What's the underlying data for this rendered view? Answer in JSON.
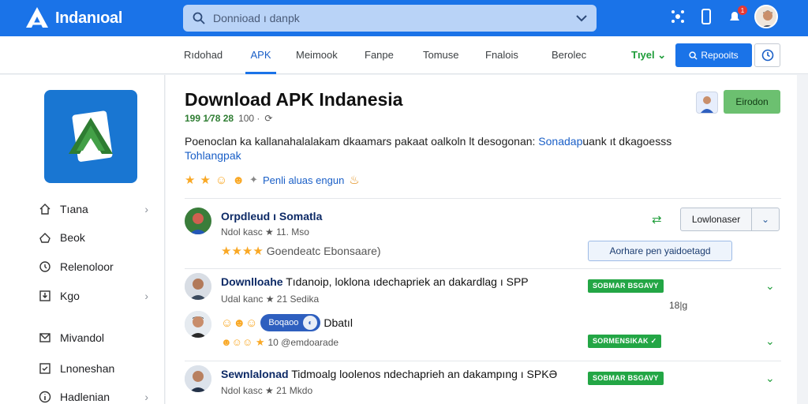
{
  "header": {
    "logo_text": "Indanıoal",
    "search_placeholder": "Donnioad ı danpk",
    "notification_count": "1"
  },
  "nav": {
    "tabs": [
      "Rıdohad",
      "APK",
      "Meimook",
      "Fanpe",
      "Tomuse",
      "Fnalois",
      "Berolec"
    ],
    "active_tab": "APK",
    "extra_tab": "Tıyel",
    "report_button": "Repooits"
  },
  "sidebar": {
    "items": [
      {
        "label": "Tıana",
        "icon": "house-icon",
        "chevron": true
      },
      {
        "label": "Beok",
        "icon": "home-outline-icon",
        "chevron": false
      },
      {
        "label": "Relenoloor",
        "icon": "clock-icon",
        "chevron": false
      },
      {
        "label": "Kgo",
        "icon": "download-box-icon",
        "chevron": true
      },
      {
        "label": "Mivandol",
        "icon": "mail-icon",
        "chevron": false
      },
      {
        "label": "Lnoneshan",
        "icon": "checkbox-icon",
        "chevron": false
      },
      {
        "label": "Hadlenian",
        "icon": "info-icon",
        "chevron": true
      }
    ]
  },
  "app": {
    "title": "Download APK Indanesia",
    "rating_text": "199 1⁄78 28",
    "downloads": "100 ·",
    "description_main": "Poenoclan ka kallanahalalakam dkaamars pakaat oalkoln lt desogonan: ",
    "description_link": "Sonadap",
    "description_rest": "uank ıt dkagoesss",
    "description_line2": "Tohlangpak",
    "stars_label": "Penli aluas engun",
    "download_button": "Eirodon"
  },
  "reviews": [
    {
      "name": "Orpdleud ı Somatla",
      "sub": "Ndol kasc ★ 11. Mso",
      "stars_text": "Goendeatc Ebonsaare)",
      "action_label": "Lowlonaser",
      "blue_button": "Aorhare pen yaidoetagd"
    },
    {
      "name": "Downlloahe",
      "name_rest": " Tıdanoip, loklona ıdechapriek an dakardlag ı SPP",
      "sub": "Udal kanc ★ 21 Sedika",
      "badge": "SOBMAR BSGAVY",
      "count": "18|g"
    },
    {
      "pill_label": "Boqaoo",
      "name_after": "Dbatıl",
      "stars_text": "10 @emdoarade",
      "badge": "SORMENSIKAK"
    },
    {
      "name": "Sewnlalonad",
      "name_rest": " Tidmoalg loolenos ndechaprieh an dakampıng ı SPKƏ",
      "sub": "Ndol kasc ★ 21 Mkdo",
      "badge": "SOBMAR BSGAVY"
    }
  ]
}
